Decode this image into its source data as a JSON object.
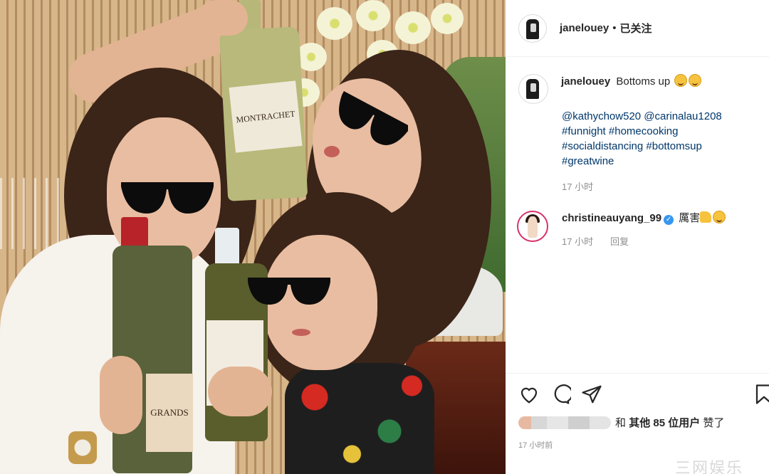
{
  "photo": {
    "bottle_labels": {
      "montrachet": "MONTRACHET",
      "grands": "GRANDS"
    }
  },
  "header": {
    "username": "janelouey",
    "separator": "•",
    "follow_status": "已关注"
  },
  "caption": {
    "username": "janelouey",
    "text": "Bottoms up",
    "emoji": [
      "grinning-squinting-face",
      "grinning-squinting-face"
    ],
    "tag_lines": [
      "@kathychow520 @carinalau1208",
      "#funnight #homecooking",
      "#socialdistancing #bottomsup",
      "#greatwine"
    ],
    "time": "17 小时"
  },
  "comment": {
    "username": "christineauyang_99",
    "verified": true,
    "text": "厲害",
    "emoji": [
      "thumbs-up",
      "rolling-on-floor-laughing"
    ],
    "time": "17 小时",
    "reply_label": "回复"
  },
  "actions": {
    "icons": [
      "heart-icon",
      "comment-icon",
      "share-icon",
      "bookmark-icon"
    ]
  },
  "likes": {
    "connector": "和",
    "others": "其他 85 位用户",
    "suffix": "赞了"
  },
  "post_time": "17 小时前",
  "watermark": "三网娱乐",
  "colors": {
    "link": "#00376b",
    "muted": "#8e8e8e",
    "verified": "#3897f0",
    "story_ring": "#d6336c"
  }
}
